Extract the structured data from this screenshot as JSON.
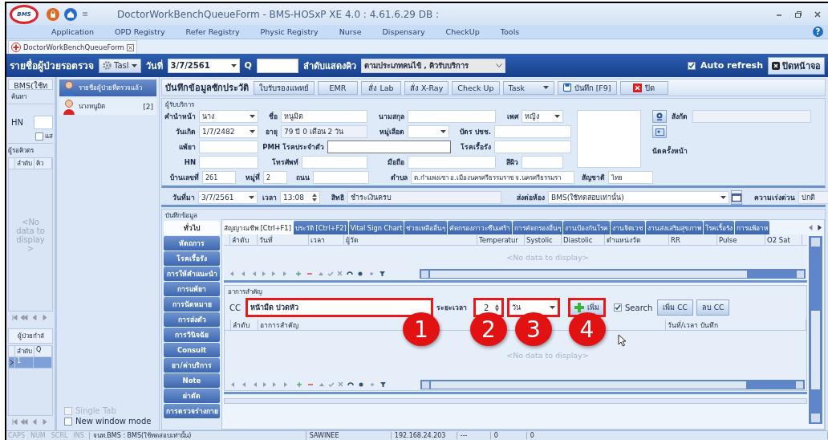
{
  "window": {
    "logo": "BMS",
    "title": "DoctorWorkBenchQueueForm - BMS-HOSxP XE 4.0 : 4.61.6.29 DB :",
    "help": "?"
  },
  "menu": [
    "Application",
    "OPD Registry",
    "Refer Registry",
    "Physic Registry",
    "Nurse",
    "Dispensary",
    "CheckUp",
    "Tools"
  ],
  "document_tabs": [
    {
      "label": "DoctorWorkBenchQueueForm",
      "selected": true
    }
  ],
  "queue_header": {
    "title": "รายชื่อผู้ป่วยรอตรวจ",
    "task_button": "Tasl",
    "date_label": "วันที่",
    "date": "3/7/2561",
    "q_label": "Q",
    "order_label": "ลำดับแสดงคิว",
    "order_value": "ตามประเภทคนไข้ , คิวรับบริการ",
    "auto_refresh": {
      "label": "Auto refresh",
      "checked": true
    },
    "close_button": "ปิดหน้าจอ"
  },
  "left_panel": {
    "title": "BMS(ใช้ท",
    "search_label": "ค้นหา",
    "hn_label": "HN",
    "show_checkbox": {
      "label": "แส",
      "checked": false
    },
    "waiting": {
      "title": "ผู้รอคิวตร",
      "columns": [
        "ลำดับ",
        "คิว"
      ],
      "empty_text": "<No data to display >"
    },
    "in_progress": {
      "title": "ผู้ป่วยกำลั",
      "columns": [
        "ลำดับ",
        "Q"
      ],
      "rows": [
        {
          "cells": [
            "1"
          ],
          "selected": true
        }
      ]
    }
  },
  "patient_list": {
    "items": [
      {
        "label": "รายชื่อผู้ป่วยที่ตรวจแล้ว",
        "kind": "doctor",
        "selected": true
      },
      {
        "label": "นางหนูมิต",
        "count": "[2]",
        "kind": "patient",
        "selected": false
      }
    ],
    "single_tab": {
      "label": "Single Tab",
      "checked": false,
      "disabled": true
    },
    "new_window": {
      "label": "New window mode",
      "checked": false,
      "disabled": false
    }
  },
  "toolbar": {
    "title": "บันทึกข้อมูลซักประวัติ",
    "buttons": [
      {
        "label": "ใบรับรองแพทย์",
        "kind": "plain"
      },
      {
        "label": "EMR",
        "kind": "plain"
      },
      {
        "label": "สั่ง Lab",
        "kind": "plain"
      },
      {
        "label": "สั่ง X-Ray",
        "kind": "plain"
      },
      {
        "label": "Check Up",
        "kind": "plain"
      },
      {
        "label": "Task",
        "kind": "dropdown"
      },
      {
        "label": "บันทึก [F9]",
        "kind": "save"
      },
      {
        "label": "ปิด",
        "kind": "close"
      }
    ]
  },
  "patient_info": {
    "title": "ผู้รับบริการ",
    "rows": [
      [
        {
          "label": "คำนำหน้า",
          "value": "นาง",
          "kind": "dropdown"
        },
        {
          "label": "ชื่อ",
          "value": "หนูมิต",
          "kind": "text"
        },
        {
          "label": "นามสกุล",
          "kind": "text"
        },
        {
          "label": "เพศ",
          "value": "หญิง",
          "kind": "dropdown"
        }
      ],
      [
        {
          "label": "วันเกิด",
          "value": "1/7/2482",
          "kind": "dropdown"
        },
        {
          "label": "อายุ",
          "value": "79 ปี 0 เดือน 2 วัน",
          "kind": "readonly"
        },
        {
          "label": "หมู่เลือด",
          "kind": "dropdown"
        },
        {
          "label": "บัตร ปชช.",
          "kind": "text"
        }
      ],
      [
        {
          "label": "แพ้ยา",
          "kind": "text"
        },
        {
          "label": "PMH โรคประจำตัว",
          "kind": "framed"
        },
        {
          "label": "โรคเรื้อรัง",
          "kind": "text"
        }
      ],
      [
        {
          "label": "HN",
          "kind": "text"
        },
        {
          "label": "โทรศัพท์",
          "kind": "text"
        },
        {
          "label": "มือถือ",
          "kind": "text"
        },
        {
          "label": "สีผิว",
          "kind": "text"
        }
      ]
    ],
    "address_row": [
      {
        "label": "บ้านเลขที่",
        "value": "261",
        "kind": "text"
      },
      {
        "label": "หมู่ที่",
        "value": "2",
        "kind": "text"
      },
      {
        "label": "ถนน",
        "kind": "text"
      },
      {
        "label": "ตำบล",
        "value": "ต.กำแพงเซา อ.เมืองนครศรีธรรมราช จ.นครศรีธรรมรา",
        "kind": "text"
      },
      {
        "label": "สัญชาติ",
        "value": "ไทย",
        "kind": "text"
      }
    ],
    "affiliation_label": "สังกัด",
    "next_appointment_label": "นัดครั้งหน้า"
  },
  "visit": [
    {
      "label": "วันที่มา",
      "value": "3/7/2561",
      "kind": "dropdown"
    },
    {
      "label": "เวลา",
      "value": "13:08",
      "kind": "spinner"
    },
    {
      "label": "สิทธิ",
      "value": "ชำระเงินครบ",
      "kind": "readonly"
    },
    {
      "label": "ส่งต่อห้อง",
      "value": "BMS(ใช้ทดสอบเท่านั้น)",
      "kind": "dropdown"
    },
    {
      "kind": "lookup"
    },
    {
      "label": "ความเร่งด่วน",
      "value": "ปกติ",
      "kind": "readonly"
    }
  ],
  "record": {
    "title": "บันทึกข้อมูล",
    "side_tabs": [
      {
        "label": "ทั่วไป",
        "selected": true
      },
      {
        "label": "หัตถการ",
        "selected": false
      },
      {
        "label": "โรคเรื้อรัง",
        "selected": false
      },
      {
        "label": "การให้คำแนะนำ",
        "selected": false
      },
      {
        "label": "การแพ้ยา",
        "selected": false
      },
      {
        "label": "การนัดหมาย",
        "selected": false
      },
      {
        "label": "การส่งตัว",
        "selected": false
      },
      {
        "label": "การวินิจฉัย",
        "selected": false
      },
      {
        "label": "Consult",
        "selected": false
      },
      {
        "label": "ยา/ค่าบริการ",
        "selected": false
      },
      {
        "label": "Note",
        "selected": false
      },
      {
        "label": "ผ่าตัด",
        "selected": false
      },
      {
        "label": "การตรวจร่างกาย",
        "selected": false
      }
    ],
    "tabs": [
      {
        "label": "สัญญาณชีพ [Ctrl+F1]",
        "selected": true
      },
      {
        "label": "ประวัติ [Ctrl+F2]",
        "selected": false
      },
      {
        "label": "Vital Sign Chart",
        "selected": false
      },
      {
        "label": "ช่วยเหลืออื่นๆ",
        "selected": false
      },
      {
        "label": "คัดกรองภาวะซึมเศร้า",
        "selected": false
      },
      {
        "label": "การคัดกรองอื่นๆ",
        "selected": false
      },
      {
        "label": "งานป้องกันโรค",
        "selected": false
      },
      {
        "label": "งานจิตเวช",
        "selected": false
      },
      {
        "label": "งานส่งเสริมสุขภาพ",
        "selected": false
      },
      {
        "label": "โรคเรื้อรัง",
        "selected": false
      },
      {
        "label": "การแพ้อาห",
        "selected": false
      }
    ],
    "vitals_table": {
      "columns": [
        "ลำดับ",
        "วันที่",
        "เวลา",
        "ผู้วัด",
        "Temperatur",
        "Systolic",
        "Diastolic",
        "ตำแหน่งวัด",
        "RR",
        "Pulse",
        "O2 Sat"
      ],
      "empty_text": "<No data to display>"
    },
    "chief_complaint": {
      "title": "อาการสำคัญ",
      "cc": {
        "label": "CC",
        "value": "หน้ามืด ปวดหัว",
        "highlighted": true,
        "callout": "1"
      },
      "duration": {
        "label": "ระยะเวลา",
        "value": "2",
        "highlighted": true,
        "callout": "2"
      },
      "unit": {
        "value": "วัน",
        "highlighted": true,
        "callout": "3"
      },
      "add_button": {
        "label": "เพิ่ม",
        "highlighted": true,
        "callout": "4"
      },
      "search": {
        "label": "Search",
        "checked": true
      },
      "add_cc_button": "เพิ่ม CC",
      "delete_cc_button": "ลบ CC",
      "columns": [
        "ลำดับ",
        "อาการสำคัญ",
        "วันที่/เวลา บันทึก"
      ],
      "empty_text": "<No data to display>"
    }
  },
  "status_bar": {
    "keys": [
      {
        "label": "CAPS",
        "on": false
      },
      {
        "label": "NUM",
        "on": false
      },
      {
        "label": "SCRL",
        "on": false
      },
      {
        "label": "INS",
        "on": false
      }
    ],
    "panels": [
      "จนท.BMS : BMS(ใช้ทดสอบเท่านั้น)",
      "SAWINEE",
      "192.168.24.203",
      "---",
      "0",
      "0"
    ]
  }
}
